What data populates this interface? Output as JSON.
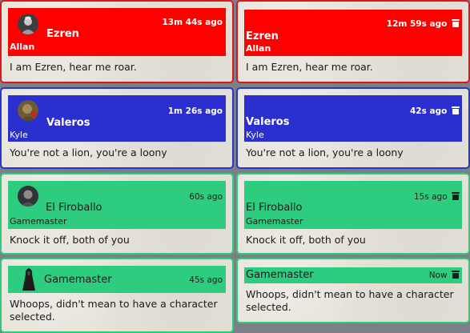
{
  "colors": {
    "red": "#ff0000",
    "blue": "#2b2fcf",
    "green": "#2ecc7e"
  },
  "left_column": [
    {
      "speaker": "Ezren",
      "player": "Allan",
      "time": "13m 44s ago",
      "message": "I am Ezren, hear me roar.",
      "avatar_icon": "ezren-portrait"
    },
    {
      "speaker": "Valeros",
      "player": "Kyle",
      "time": "1m 26s ago",
      "message": "You're not a lion, you're a loony",
      "avatar_icon": "valeros-portrait"
    },
    {
      "speaker": "El Firoballo",
      "player": "Gamemaster",
      "time": "60s ago",
      "message": "Knock it off, both of you",
      "avatar_icon": "firoballo-portrait"
    },
    {
      "speaker": "Gamemaster",
      "time": "45s ago",
      "message": "Whoops, didn't mean to have a character selected.",
      "avatar_icon": "hooded-figure"
    }
  ],
  "right_column": [
    {
      "speaker": "Ezren",
      "player": "Allan",
      "time": "12m 59s ago",
      "message": "I am Ezren, hear me roar.",
      "delete_icon": "trash-icon"
    },
    {
      "speaker": "Valeros",
      "player": "Kyle",
      "time": "42s ago",
      "message": "You're not a lion, you're a loony",
      "delete_icon": "trash-icon"
    },
    {
      "speaker": "El Firoballo",
      "player": "Gamemaster",
      "time": "15s ago",
      "message": "Knock it off, both of you",
      "delete_icon": "trash-icon"
    },
    {
      "speaker": "Gamemaster",
      "time": "Now",
      "message": "Whoops, didn't mean to have a character selected.",
      "delete_icon": "trash-icon"
    }
  ]
}
